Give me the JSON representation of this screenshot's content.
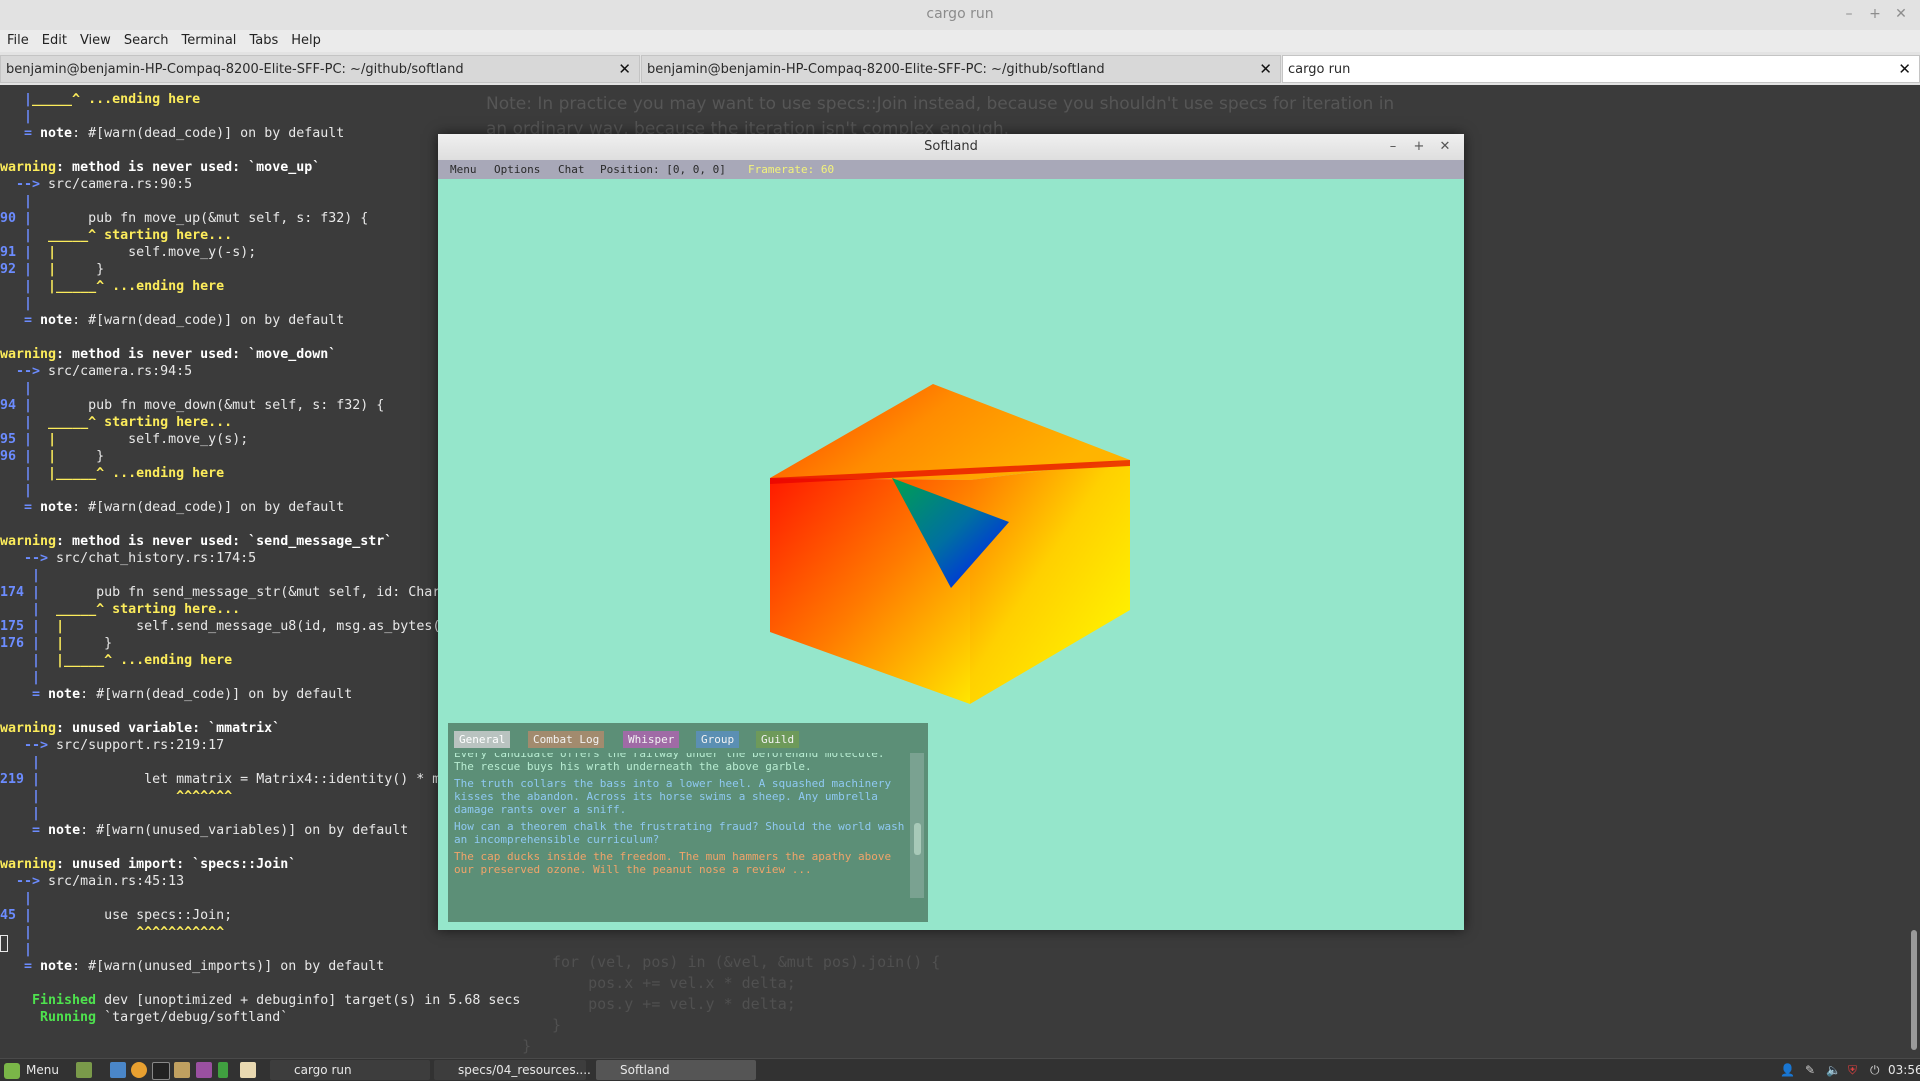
{
  "window": {
    "title": "cargo run",
    "controls": [
      "–",
      "+",
      "✕"
    ]
  },
  "menubar": [
    "File",
    "Edit",
    "View",
    "Search",
    "Terminal",
    "Tabs",
    "Help"
  ],
  "tabs": [
    {
      "label": "benjamin@benjamin-HP-Compaq-8200-Elite-SFF-PC: ~/github/softland",
      "active": false
    },
    {
      "label": "benjamin@benjamin-HP-Compaq-8200-Elite-SFF-PC: ~/github/softland",
      "active": false
    },
    {
      "label": "cargo run",
      "active": true
    }
  ],
  "terminal": {
    "lines": [
      {
        "y": 0,
        "segs": [
          {
            "t": "   |",
            "c": "b"
          },
          {
            "t": "_____^ ...ending here",
            "c": "y"
          }
        ]
      },
      {
        "y": 1,
        "segs": [
          {
            "t": "   |",
            "c": "b"
          }
        ]
      },
      {
        "y": 2,
        "segs": [
          {
            "t": "   = ",
            "c": "b"
          },
          {
            "t": "note",
            "c": "nb"
          },
          {
            "t": ": #[warn(dead_code)] on by default",
            "c": ""
          }
        ]
      },
      {
        "y": 3,
        "segs": []
      },
      {
        "y": 4,
        "segs": [
          {
            "t": "warning",
            "c": "w"
          },
          {
            "t": ": method is never used: `move_up`",
            "c": "wb"
          }
        ]
      },
      {
        "y": 5,
        "segs": [
          {
            "t": "  --> ",
            "c": "b"
          },
          {
            "t": "src/camera.rs:90:5",
            "c": ""
          }
        ]
      },
      {
        "y": 6,
        "segs": [
          {
            "t": "   |",
            "c": "b"
          }
        ]
      },
      {
        "y": 7,
        "segs": [
          {
            "t": "90 ",
            "c": "b"
          },
          {
            "t": "|",
            "c": "b"
          },
          {
            "t": "       pub fn move_up(&mut self, s: f32) {",
            "c": ""
          }
        ]
      },
      {
        "y": 8,
        "segs": [
          {
            "t": "   |  ",
            "c": "b"
          },
          {
            "t": "_____^ starting here...",
            "c": "y"
          }
        ]
      },
      {
        "y": 9,
        "segs": [
          {
            "t": "91 ",
            "c": "b"
          },
          {
            "t": "|  ",
            "c": "b"
          },
          {
            "t": "|",
            "c": "y"
          },
          {
            "t": "         self.move_y(-s);",
            "c": ""
          }
        ]
      },
      {
        "y": 10,
        "segs": [
          {
            "t": "92 ",
            "c": "b"
          },
          {
            "t": "|  ",
            "c": "b"
          },
          {
            "t": "|",
            "c": "y"
          },
          {
            "t": "     }",
            "c": ""
          }
        ]
      },
      {
        "y": 11,
        "segs": [
          {
            "t": "   |  ",
            "c": "b"
          },
          {
            "t": "|_____^ ...ending here",
            "c": "y"
          }
        ]
      },
      {
        "y": 12,
        "segs": [
          {
            "t": "   |",
            "c": "b"
          }
        ]
      },
      {
        "y": 13,
        "segs": [
          {
            "t": "   = ",
            "c": "b"
          },
          {
            "t": "note",
            "c": "nb"
          },
          {
            "t": ": #[warn(dead_code)] on by default",
            "c": ""
          }
        ]
      },
      {
        "y": 14,
        "segs": []
      },
      {
        "y": 15,
        "segs": [
          {
            "t": "warning",
            "c": "w"
          },
          {
            "t": ": method is never used: `move_down`",
            "c": "wb"
          }
        ]
      },
      {
        "y": 16,
        "segs": [
          {
            "t": "  --> ",
            "c": "b"
          },
          {
            "t": "src/camera.rs:94:5",
            "c": ""
          }
        ]
      },
      {
        "y": 17,
        "segs": [
          {
            "t": "   |",
            "c": "b"
          }
        ]
      },
      {
        "y": 18,
        "segs": [
          {
            "t": "94 ",
            "c": "b"
          },
          {
            "t": "|",
            "c": "b"
          },
          {
            "t": "       pub fn move_down(&mut self, s: f32) {",
            "c": ""
          }
        ]
      },
      {
        "y": 19,
        "segs": [
          {
            "t": "   |  ",
            "c": "b"
          },
          {
            "t": "_____^ starting here...",
            "c": "y"
          }
        ]
      },
      {
        "y": 20,
        "segs": [
          {
            "t": "95 ",
            "c": "b"
          },
          {
            "t": "|  ",
            "c": "b"
          },
          {
            "t": "|",
            "c": "y"
          },
          {
            "t": "         self.move_y(s);",
            "c": ""
          }
        ]
      },
      {
        "y": 21,
        "segs": [
          {
            "t": "96 ",
            "c": "b"
          },
          {
            "t": "|  ",
            "c": "b"
          },
          {
            "t": "|",
            "c": "y"
          },
          {
            "t": "     }",
            "c": ""
          }
        ]
      },
      {
        "y": 22,
        "segs": [
          {
            "t": "   |  ",
            "c": "b"
          },
          {
            "t": "|_____^ ...ending here",
            "c": "y"
          }
        ]
      },
      {
        "y": 23,
        "segs": [
          {
            "t": "   |",
            "c": "b"
          }
        ]
      },
      {
        "y": 24,
        "segs": [
          {
            "t": "   = ",
            "c": "b"
          },
          {
            "t": "note",
            "c": "nb"
          },
          {
            "t": ": #[warn(dead_code)] on by default",
            "c": ""
          }
        ]
      },
      {
        "y": 25,
        "segs": []
      },
      {
        "y": 26,
        "segs": [
          {
            "t": "warning",
            "c": "w"
          },
          {
            "t": ": method is never used: `send_message_str`",
            "c": "wb"
          }
        ]
      },
      {
        "y": 27,
        "segs": [
          {
            "t": "   --> ",
            "c": "b"
          },
          {
            "t": "src/chat_history.rs:174:5",
            "c": ""
          }
        ]
      },
      {
        "y": 28,
        "segs": [
          {
            "t": "    |",
            "c": "b"
          }
        ]
      },
      {
        "y": 29,
        "segs": [
          {
            "t": "174 ",
            "c": "b"
          },
          {
            "t": "|",
            "c": "b"
          },
          {
            "t": "       pub fn send_message_str(&mut self, id: Char",
            "c": ""
          }
        ]
      },
      {
        "y": 30,
        "segs": [
          {
            "t": "    |  ",
            "c": "b"
          },
          {
            "t": "_____^ starting here...",
            "c": "y"
          }
        ]
      },
      {
        "y": 31,
        "segs": [
          {
            "t": "175 ",
            "c": "b"
          },
          {
            "t": "|  ",
            "c": "b"
          },
          {
            "t": "|",
            "c": "y"
          },
          {
            "t": "         self.send_message_u8(id, msg.as_bytes()",
            "c": ""
          }
        ]
      },
      {
        "y": 32,
        "segs": [
          {
            "t": "176 ",
            "c": "b"
          },
          {
            "t": "|  ",
            "c": "b"
          },
          {
            "t": "|",
            "c": "y"
          },
          {
            "t": "     }",
            "c": ""
          }
        ]
      },
      {
        "y": 33,
        "segs": [
          {
            "t": "    |  ",
            "c": "b"
          },
          {
            "t": "|_____^ ...ending here",
            "c": "y"
          }
        ]
      },
      {
        "y": 34,
        "segs": [
          {
            "t": "    |",
            "c": "b"
          }
        ]
      },
      {
        "y": 35,
        "segs": [
          {
            "t": "    = ",
            "c": "b"
          },
          {
            "t": "note",
            "c": "nb"
          },
          {
            "t": ": #[warn(dead_code)] on by default",
            "c": ""
          }
        ]
      },
      {
        "y": 36,
        "segs": []
      },
      {
        "y": 37,
        "segs": [
          {
            "t": "warning",
            "c": "w"
          },
          {
            "t": ": unused variable: `mmatrix`",
            "c": "wb"
          }
        ]
      },
      {
        "y": 38,
        "segs": [
          {
            "t": "   --> ",
            "c": "b"
          },
          {
            "t": "src/support.rs:219:17",
            "c": ""
          }
        ]
      },
      {
        "y": 39,
        "segs": [
          {
            "t": "    |",
            "c": "b"
          }
        ]
      },
      {
        "y": 40,
        "segs": [
          {
            "t": "219 ",
            "c": "b"
          },
          {
            "t": "|",
            "c": "b"
          },
          {
            "t": "             let mmatrix = Matrix4::identity() * m",
            "c": ""
          }
        ]
      },
      {
        "y": 41,
        "segs": [
          {
            "t": "    |",
            "c": "b"
          },
          {
            "t": "                 ^^^^^^^",
            "c": "y"
          }
        ]
      },
      {
        "y": 42,
        "segs": [
          {
            "t": "    |",
            "c": "b"
          }
        ]
      },
      {
        "y": 43,
        "segs": [
          {
            "t": "    = ",
            "c": "b"
          },
          {
            "t": "note",
            "c": "nb"
          },
          {
            "t": ": #[warn(unused_variables)] on by default",
            "c": ""
          }
        ]
      },
      {
        "y": 44,
        "segs": []
      },
      {
        "y": 45,
        "segs": [
          {
            "t": "warning",
            "c": "w"
          },
          {
            "t": ": unused import: `specs::Join`",
            "c": "wb"
          }
        ]
      },
      {
        "y": 46,
        "segs": [
          {
            "t": "  --> ",
            "c": "b"
          },
          {
            "t": "src/main.rs:45:13",
            "c": ""
          }
        ]
      },
      {
        "y": 47,
        "segs": [
          {
            "t": "   |",
            "c": "b"
          }
        ]
      },
      {
        "y": 48,
        "segs": [
          {
            "t": "45 ",
            "c": "b"
          },
          {
            "t": "|",
            "c": "b"
          },
          {
            "t": "         use specs::Join;",
            "c": ""
          }
        ]
      },
      {
        "y": 49,
        "segs": [
          {
            "t": "   |",
            "c": "b"
          },
          {
            "t": "             ^^^^^^^^^^^",
            "c": "y"
          }
        ]
      },
      {
        "y": 50,
        "segs": [
          {
            "t": "   |",
            "c": "b"
          }
        ]
      },
      {
        "y": 51,
        "segs": [
          {
            "t": "   = ",
            "c": "b"
          },
          {
            "t": "note",
            "c": "nb"
          },
          {
            "t": ": #[warn(unused_imports)] on by default",
            "c": ""
          }
        ]
      },
      {
        "y": 52,
        "segs": []
      },
      {
        "y": 53,
        "segs": [
          {
            "t": "    Finished",
            "c": "g"
          },
          {
            "t": " dev [unoptimized + debuginfo] target(s) in 5.68 secs",
            "c": ""
          }
        ]
      },
      {
        "y": 54,
        "segs": [
          {
            "t": "     Running",
            "c": "g"
          },
          {
            "t": " `target/debug/softland`",
            "c": ""
          }
        ]
      }
    ]
  },
  "background_doc": {
    "prose_line1": "Note: In practice you may want to use  specs::Join  instead, because you shouldn't use  specs  for  iteration  in",
    "prose_line2": "an  ordinary  way,  because  the  iteration  isn't  complex  enough.",
    "code": [
      "for (vel, pos) in (&vel, &mut pos).join() {",
      "    pos.x += vel.x * delta;",
      "    pos.y += vel.y * delta;",
      "}",
      "    }"
    ]
  },
  "softland": {
    "title": "Softland",
    "controls": [
      "–",
      "+",
      "✕"
    ],
    "menu": {
      "menu": "Menu",
      "options": "Options",
      "chat": "Chat",
      "position": "Position: [0, 0, 0]",
      "framerate": "Framerate: 60"
    },
    "chat": {
      "tabs": [
        {
          "label": "General",
          "bg": "#b9c3c0",
          "fg": "#ffffff"
        },
        {
          "label": "Combat Log",
          "bg": "#a28b6e",
          "fg": "#f2f2f2"
        },
        {
          "label": "Whisper",
          "bg": "#a06ba6",
          "fg": "#f2f2f2"
        },
        {
          "label": "Group",
          "bg": "#5b8fb3",
          "fg": "#f2f2f2"
        },
        {
          "label": "Guild",
          "bg": "#6e9a5a",
          "fg": "#f2f2f2"
        }
      ],
      "messages": [
        {
          "text": "        Every candidate offers the railway under the beforehand molecule. The rescue buys his wrath underneath the above garble.",
          "color": "#b8ecd2"
        },
        {
          "text": "The truth collars the bass into a lower heel. A squashed machinery kisses the abandon. Across its horse swims a sheep. Any umbrella damage rants over a sniff.",
          "color": "#8fc9f2"
        },
        {
          "text": "        How can a theorem chalk the frustrating fraud? Should the world wash an incomprehensible curriculum?",
          "color": "#8fc9f2"
        },
        {
          "text": "The cap ducks inside the freedom. The mum hammers the apathy above our preserved ozone. Will the peanut nose a review ...",
          "color": "#f0a46a"
        }
      ]
    }
  },
  "taskbar": {
    "menu_label": "Menu",
    "windows": [
      {
        "label": "cargo run",
        "active": false
      },
      {
        "label": "specs/04_resources....",
        "active": false
      },
      {
        "label": "Softland",
        "active": true
      }
    ],
    "clock": "03:56"
  }
}
